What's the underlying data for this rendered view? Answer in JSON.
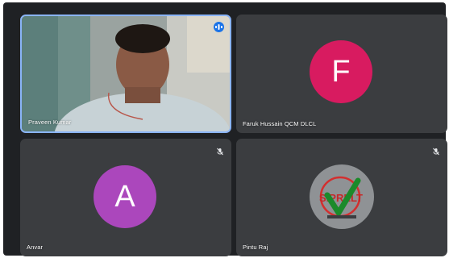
{
  "participants": [
    {
      "name": "Praveen Kumar",
      "state": "speaking",
      "video": "camera"
    },
    {
      "name": "Faruk Hussain QCM DLCL",
      "initial": "F",
      "avatar_color": "#d81b60",
      "state": "muted-hidden"
    },
    {
      "name": "Anvar",
      "initial": "A",
      "avatar_color": "#ab47bc",
      "state": "muted"
    },
    {
      "name": "Pintu Raj",
      "state": "muted",
      "logo_text": "SIPRELT"
    }
  ],
  "icons": {
    "speaking": "audio-level-icon",
    "muted": "mic-off-icon"
  },
  "colors": {
    "stage": "#1f2124",
    "tile": "#3b3d40",
    "active_border": "#8ab4f8"
  }
}
